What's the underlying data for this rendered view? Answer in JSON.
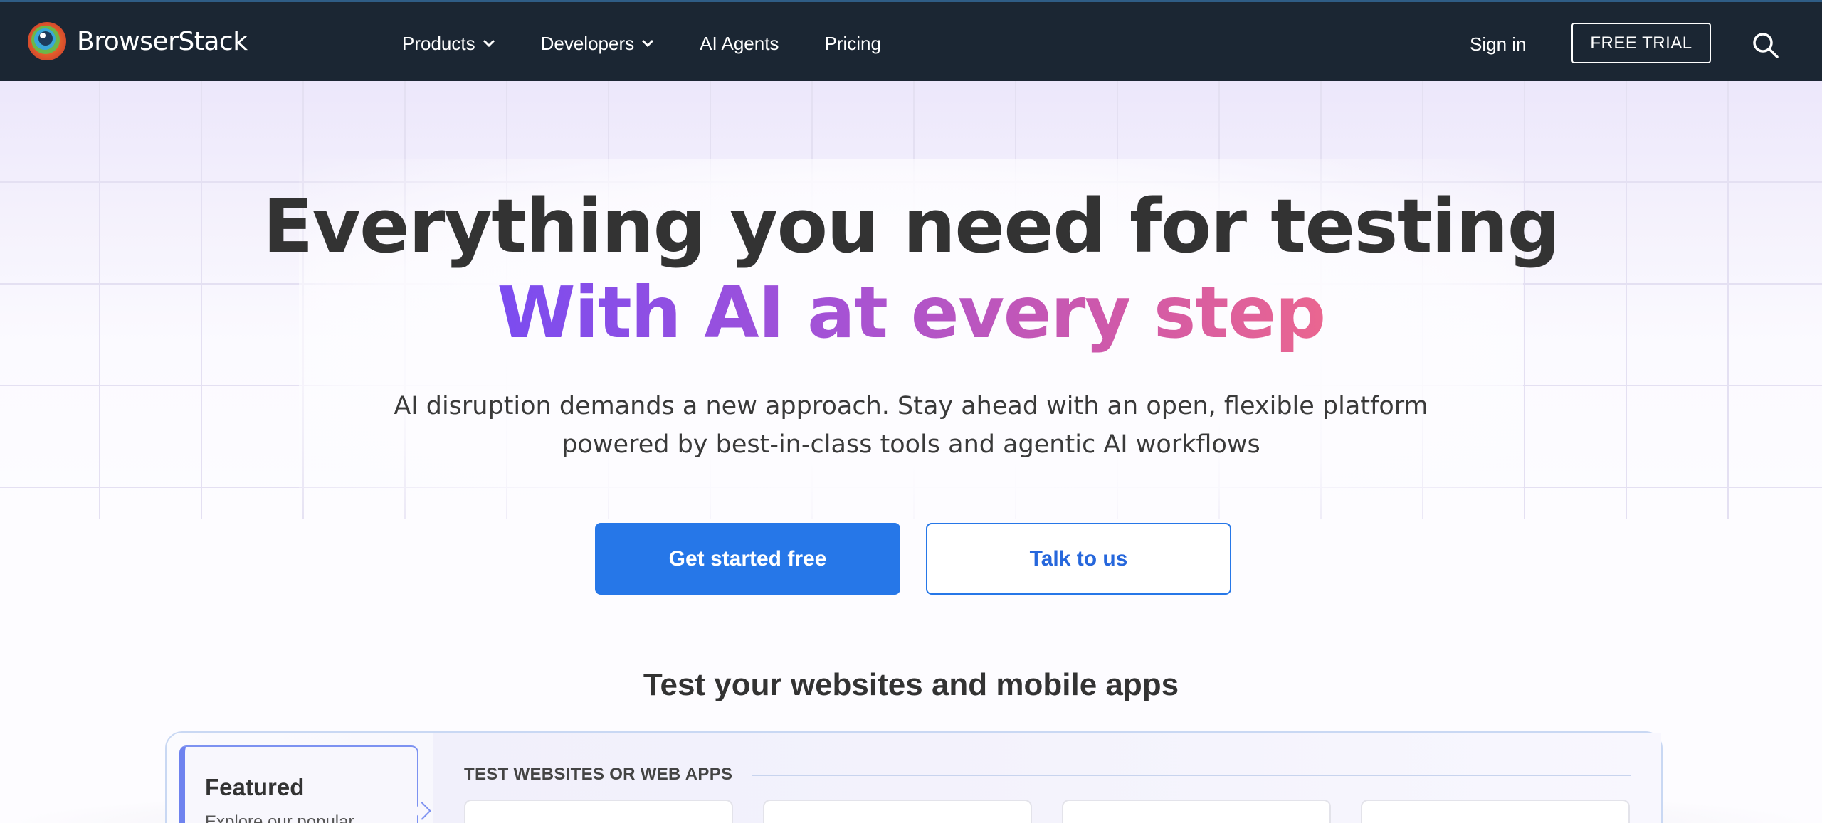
{
  "brand": {
    "name": "BrowserStack",
    "logo_icon": "browserstack-logo-icon"
  },
  "nav": {
    "items": [
      {
        "label": "Products",
        "has_dropdown": true
      },
      {
        "label": "Developers",
        "has_dropdown": true
      },
      {
        "label": "AI Agents",
        "has_dropdown": false
      },
      {
        "label": "Pricing",
        "has_dropdown": false
      }
    ],
    "sign_in": "Sign in",
    "free_trial": "FREE TRIAL",
    "search_icon": "search-icon"
  },
  "hero": {
    "title": "Everything you need for testing",
    "subtitle": "With AI at every step",
    "description_line1": "AI disruption demands a new approach. Stay ahead with an open, flexible platform",
    "description_line2": "powered by best-in-class tools and agentic AI workflows",
    "primary_cta": "Get started free",
    "secondary_cta": "Talk to us"
  },
  "products": {
    "section_title": "Test your websites and mobile apps",
    "featured_tab": {
      "title": "Featured",
      "description": "Explore our popular"
    },
    "group_heading": "TEST WEBSITES OR WEB APPS"
  },
  "colors": {
    "navbar_bg": "#1b2633",
    "primary_blue": "#2677e8",
    "gradient_start": "#7b4cf0",
    "gradient_end": "#ea6690",
    "heading_text": "#333333"
  }
}
